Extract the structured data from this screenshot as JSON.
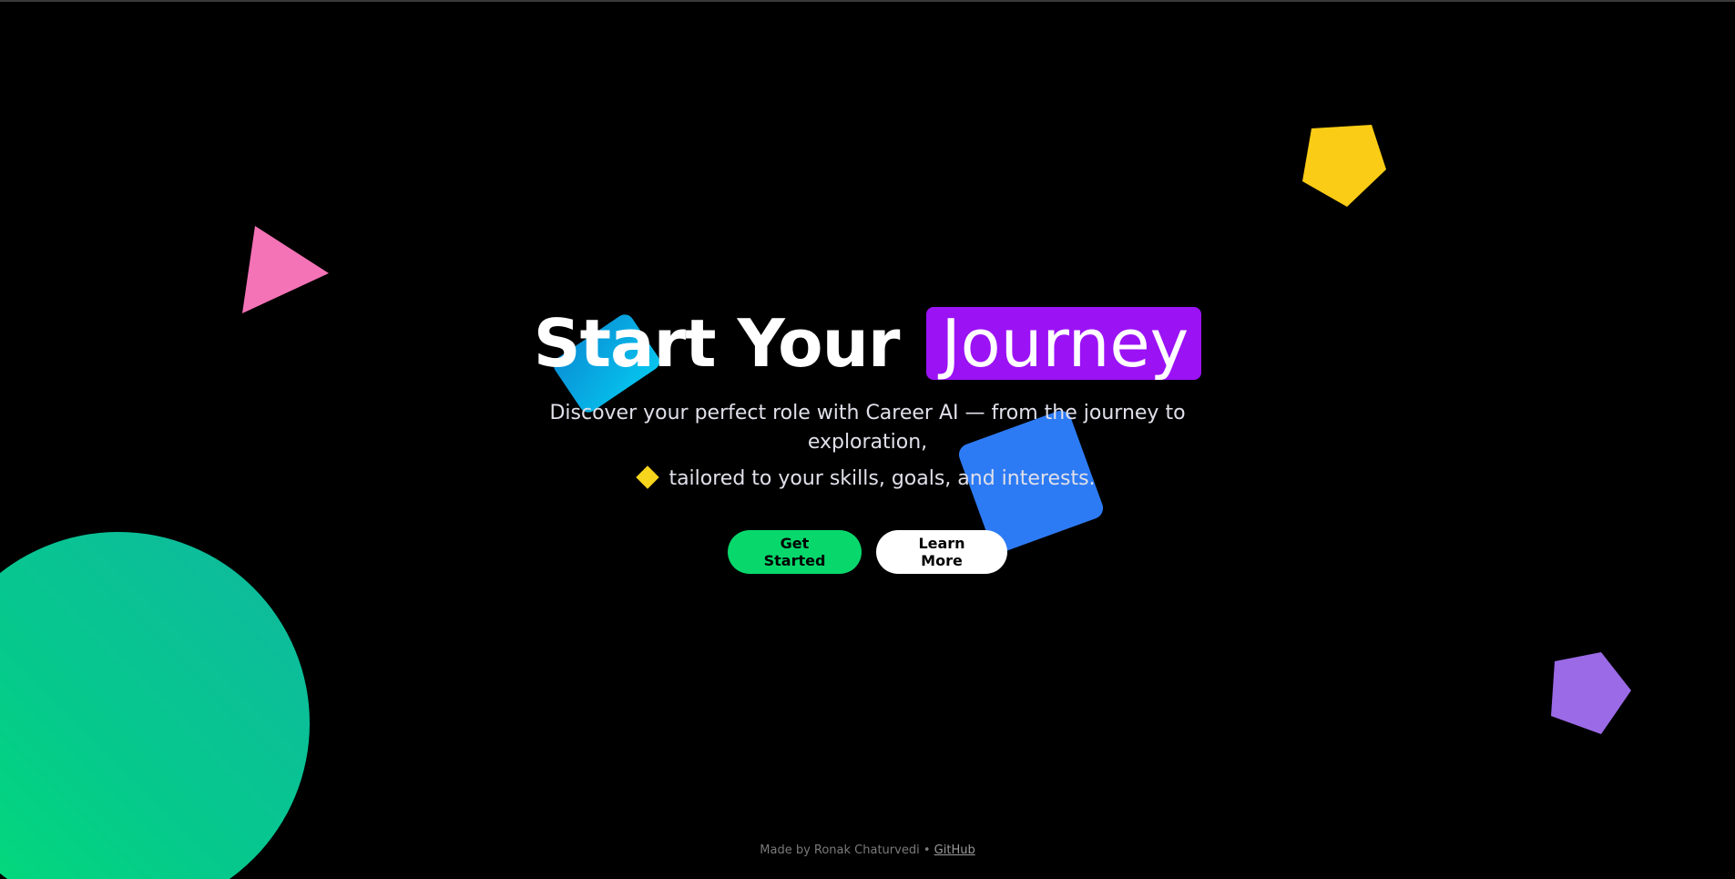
{
  "hero": {
    "title_part1": "Start Your",
    "title_highlight": "Journey",
    "subtitle": "Discover your perfect role with Career AI — from the journey to exploration,",
    "tagline": "tailored to your skills, goals, and interests."
  },
  "buttons": {
    "primary_label": "Get Started",
    "secondary_label": "Learn More"
  },
  "footer": {
    "credit": "Made by Ronak Chaturvedi",
    "separator": "•",
    "link_label": "GitHub"
  },
  "icons": {
    "tagline_bullet": "diamond-icon"
  },
  "colors": {
    "background": "#000000",
    "highlight": "#9b12f5",
    "primary_button": "#08d86c",
    "secondary_button": "#ffffff",
    "triangle": "#f472b6",
    "pentagon_yellow": "#facc15",
    "pentagon_purple": "#9b6ae6",
    "square_blue": "#2d7bf4",
    "square_cyan": "#05c6ee",
    "circle": "#05c98c"
  }
}
